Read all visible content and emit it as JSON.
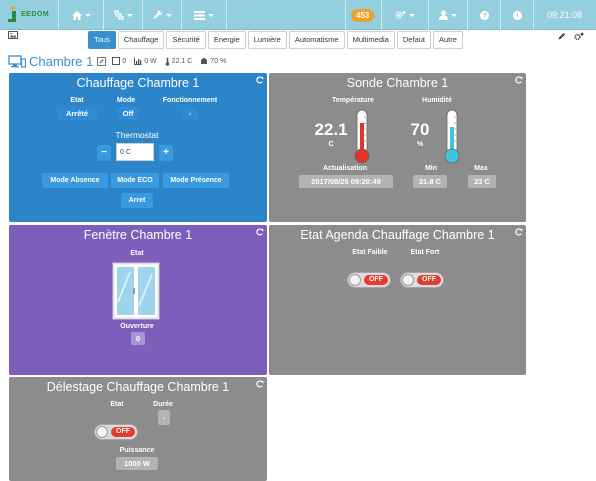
{
  "app": {
    "logo_text": "EEDOM",
    "clock": "09:21:08",
    "messages_count": "453"
  },
  "navbar": {
    "items": [
      {
        "icon": "home-icon"
      },
      {
        "icon": "analysis-icon"
      },
      {
        "icon": "tools-icon"
      },
      {
        "icon": "plugins-icon"
      }
    ],
    "right_icons": [
      "gears-icon",
      "user-icon",
      "help-icon",
      "info-icon"
    ]
  },
  "categories": [
    "Tous",
    "Chauffage",
    "Sécurité",
    "Energie",
    "Lumière",
    "Automatisme",
    "Multimedia",
    "Defaut",
    "Autre"
  ],
  "active_category": "Tous",
  "object": {
    "name": "Chambre 1",
    "summary": {
      "lights": "0",
      "power": "0 W",
      "temperature": "22.1 C",
      "humidity": "70 %"
    }
  },
  "widgets": {
    "chauffage": {
      "title": "Chauffage Chambre 1",
      "etat_label": "Etat",
      "etat_value": "Arrêté",
      "mode_label": "Mode",
      "mode_value": "Off",
      "fonct_label": "Fonctionnement",
      "fonct_value": "-",
      "thermostat_label": "Thermostat",
      "thermostat_minus": "−",
      "thermostat_plus": "+",
      "thermostat_value": "0 C",
      "buttons": [
        "Mode Absence",
        "Mode ECO",
        "Mode Présence"
      ],
      "stop_button": "Arret",
      "color": "#2c85c9"
    },
    "sonde": {
      "title": "Sonde Chambre 1",
      "temp_label": "Température",
      "temp_value": "22.1",
      "temp_unit": "C",
      "hum_label": "Humidité",
      "hum_value": "70",
      "hum_unit": "%",
      "actualisation_label": "Actualisation",
      "actualisation_value": "2017/08/25 09:20:49",
      "min_label": "Min",
      "min_value": "21.8 C",
      "max_label": "Max",
      "max_value": "23 C",
      "color": "#8c8c8c"
    },
    "fenetre": {
      "title": "Fenètre Chambre 1",
      "etat_label": "Etat",
      "ouverture_label": "Ouverture",
      "ouverture_value": "0",
      "color": "#7d5ebb"
    },
    "agenda": {
      "title": "Etat Agenda Chauffage Chambre 1",
      "faible_label": "Etat Faible",
      "faible_state": "OFF",
      "fort_label": "Etat Fort",
      "fort_state": "OFF",
      "color": "#8c8c8c"
    },
    "delestage": {
      "title": "Délestage Chauffage Chambre 1",
      "etat_label": "Etat",
      "etat_state": "OFF",
      "duree_label": "Durée",
      "duree_value": "-",
      "puissance_label": "Puissance",
      "puissance_value": "1000 W",
      "color": "#8c8c8c"
    }
  }
}
